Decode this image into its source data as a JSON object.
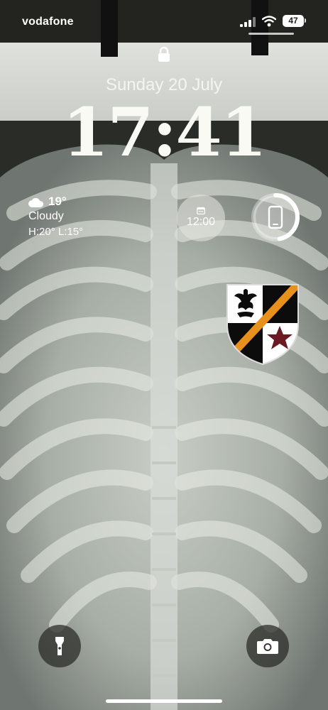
{
  "status_bar": {
    "carrier": "vodafone",
    "battery_level": "47",
    "icons": [
      "signal-icon",
      "wifi-icon",
      "battery-icon"
    ]
  },
  "lock_screen": {
    "lock_icon": "lock-icon",
    "date": "Sunday 20 July",
    "time": "17:41"
  },
  "widgets": {
    "weather": {
      "icon": "cloud-icon",
      "temperature": "19°",
      "condition": "Cloudy",
      "high_low": "H:20° L:15°"
    },
    "clock": {
      "icon": "calendar-icon",
      "time": "12:00"
    },
    "battery_ring": {
      "icon": "phone-icon",
      "level": 0.47
    },
    "crest": {
      "icon": "club-crest-icon",
      "colors": [
        "#000000",
        "#ffffff",
        "#e8901c",
        "#6b1a24"
      ]
    }
  },
  "quick_actions": {
    "flashlight": "flashlight-icon",
    "camera": "camera-icon"
  }
}
